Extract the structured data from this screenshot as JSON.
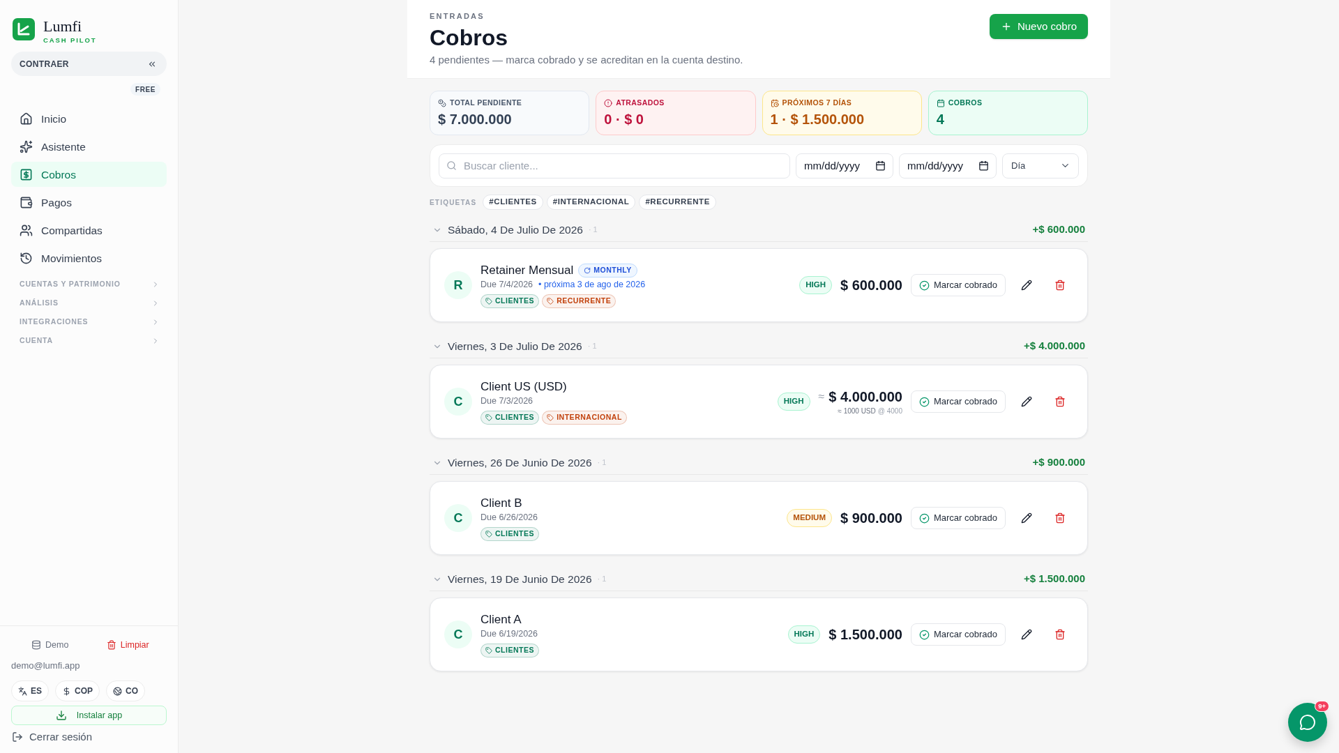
{
  "sidebar": {
    "brand": {
      "name": "Lumfi",
      "tagline": "CASH PILOT"
    },
    "collapse_button": "CONTRAER",
    "plan_badge": "FREE",
    "nav_items": [
      {
        "label": "Inicio",
        "selected": false
      },
      {
        "label": "Asistente",
        "selected": false
      },
      {
        "label": "Cobros",
        "selected": true
      },
      {
        "label": "Pagos",
        "selected": false
      },
      {
        "label": "Compartidas",
        "selected": false
      },
      {
        "label": "Movimientos",
        "selected": false
      }
    ],
    "sections": [
      {
        "label": "CUENTAS Y PATRIMONIO",
        "expanded": false
      },
      {
        "label": "ANÁLISIS",
        "expanded": false
      },
      {
        "label": "INTEGRACIONES",
        "expanded": false
      },
      {
        "label": "CUENTA",
        "expanded": false
      }
    ],
    "footer": {
      "demo_button": "Demo",
      "clear_button": "Limpiar",
      "email": "demo@lumfi.app",
      "preferences": [
        "ES",
        "COP",
        "CO"
      ],
      "install_button": "Instalar app",
      "logout_button": "Cerrar sesión"
    }
  },
  "page_header": {
    "eyebrow": "ENTRADAS",
    "title": "Cobros",
    "subtitle": "4 pendientes — marca cobrado y se acreditan en la cuenta destino.",
    "primary_button": "Nuevo cobro"
  },
  "summary_cards": [
    {
      "kind": "total",
      "label": "TOTAL PENDIENTE",
      "value": "$ 7.000.000"
    },
    {
      "kind": "overdue",
      "label": "ATRASADOS",
      "value": "0 · $ 0"
    },
    {
      "kind": "upcoming",
      "label": "PRÓXIMOS 7 DÍAS",
      "value": "1 · $ 1.500.000"
    },
    {
      "kind": "count",
      "label": "COBROS",
      "value": "4"
    }
  ],
  "filters": {
    "search": {
      "placeholder": "Buscar cliente..."
    },
    "date_from": {
      "placeholder": "mm/dd/yyyy"
    },
    "date_to": {
      "placeholder": "mm/dd/yyyy"
    },
    "grouping": {
      "value": "Día"
    }
  },
  "tag_filter": {
    "label": "ETIQUETAS",
    "tags": [
      "#CLIENTES",
      "#INTERNACIONAL",
      "#RECURRENTE"
    ]
  },
  "groups": [
    {
      "date": "Sábado, 4 De Julio De 2026",
      "count": "· 1",
      "total": "+$ 600.000",
      "expanded": true,
      "items": [
        {
          "initial": "R",
          "name": "Retainer Mensual",
          "recurrence": "MONTHLY",
          "due": "Due 7/4/2026",
          "next": "• próxima 3 de ago de 2026",
          "tags": [
            {
              "label": "CLIENTES",
              "color": "#047857"
            },
            {
              "label": "RECURRENTE",
              "color": "#c2410c"
            }
          ],
          "priority": {
            "label": "HIGH",
            "kind": "high"
          },
          "amount": "$ 600.000",
          "action_button": "Marcar cobrado"
        }
      ]
    },
    {
      "date": "Viernes, 3 De Julio De 2026",
      "count": "· 1",
      "total": "+$ 4.000.000",
      "expanded": true,
      "items": [
        {
          "initial": "C",
          "name": "Client US (USD)",
          "due": "Due 7/3/2026",
          "tags": [
            {
              "label": "CLIENTES",
              "color": "#047857"
            },
            {
              "label": "INTERNACIONAL",
              "color": "#c2410c"
            }
          ],
          "priority": {
            "label": "HIGH",
            "kind": "high"
          },
          "amount_prefix": "≈",
          "amount": "$ 4.000.000",
          "conversion": "≈ 1000 USD",
          "rate": "@ 4000",
          "action_button": "Marcar cobrado"
        }
      ]
    },
    {
      "date": "Viernes, 26 De Junio De 2026",
      "count": "· 1",
      "total": "+$ 900.000",
      "expanded": true,
      "items": [
        {
          "initial": "C",
          "name": "Client B",
          "due": "Due 6/26/2026",
          "tags": [
            {
              "label": "CLIENTES",
              "color": "#047857"
            }
          ],
          "priority": {
            "label": "MEDIUM",
            "kind": "medium"
          },
          "amount": "$ 900.000",
          "action_button": "Marcar cobrado"
        }
      ]
    },
    {
      "date": "Viernes, 19 De Junio De 2026",
      "count": "· 1",
      "total": "+$ 1.500.000",
      "expanded": true,
      "items": [
        {
          "initial": "C",
          "name": "Client A",
          "due": "Due 6/19/2026",
          "tags": [
            {
              "label": "CLIENTES",
              "color": "#047857"
            }
          ],
          "priority": {
            "label": "HIGH",
            "kind": "high"
          },
          "amount": "$ 1.500.000",
          "action_button": "Marcar cobrado"
        }
      ]
    }
  ],
  "chat_button": {
    "badge": "9+"
  }
}
